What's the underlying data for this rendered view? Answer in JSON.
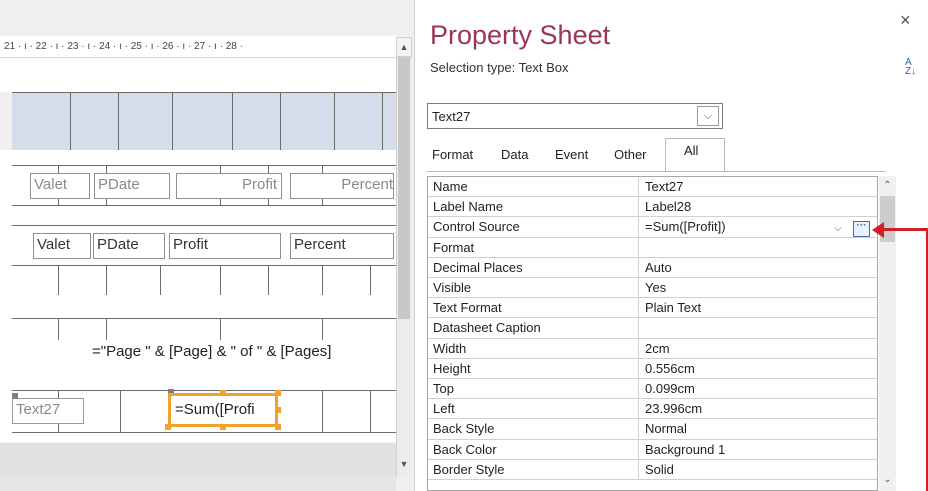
{
  "design": {
    "ruler": "21 · ı · 22 · ı · 23 · ı · 24 · ı · 25 · ı · 26 · ı · 27 · ı · 28 ·",
    "header_labels": [
      "Valet",
      "PDate",
      "Profit",
      "Percent"
    ],
    "detail_fields": [
      "Valet",
      "PDate",
      "Profit",
      "Percent"
    ],
    "page_expression": "=\"Page \" & [Page] & \" of \" & [Pages]",
    "footer_label": "Text27",
    "footer_sum": "=Sum([Profi"
  },
  "panel": {
    "title": "Property Sheet",
    "selection_type": "Selection type:  Text Box",
    "sort_icon": "az-sort-icon",
    "close_glyph": "×",
    "combo_value": "Text27",
    "tabs": [
      "Format",
      "Data",
      "Event",
      "Other",
      "All"
    ],
    "active_tab": "All",
    "properties": [
      {
        "name": "Name",
        "value": "Text27"
      },
      {
        "name": "Label Name",
        "value": "Label28"
      },
      {
        "name": "Control Source",
        "value": "=Sum([Profit])"
      },
      {
        "name": "Format",
        "value": ""
      },
      {
        "name": "Decimal Places",
        "value": "Auto"
      },
      {
        "name": "Visible",
        "value": "Yes"
      },
      {
        "name": "Text Format",
        "value": "Plain Text"
      },
      {
        "name": "Datasheet Caption",
        "value": ""
      },
      {
        "name": "Width",
        "value": "2cm"
      },
      {
        "name": "Height",
        "value": "0.556cm"
      },
      {
        "name": "Top",
        "value": "0.099cm"
      },
      {
        "name": "Left",
        "value": "23.996cm"
      },
      {
        "name": "Back Style",
        "value": "Normal"
      },
      {
        "name": "Back Color",
        "value": "Background 1"
      },
      {
        "name": "Border Style",
        "value": "Solid"
      }
    ],
    "builder_glyph": "···"
  },
  "colors": {
    "title": "#9b3553",
    "selection": "#f0a22f",
    "annotation_arrow": "#d11f2a",
    "header_band": "#d4dde9"
  }
}
